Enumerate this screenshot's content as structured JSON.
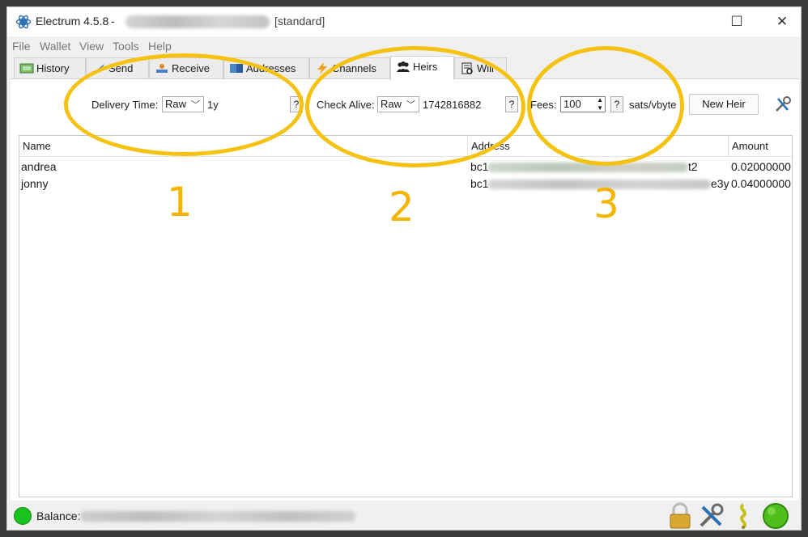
{
  "window": {
    "app_title": "Electrum 4.5.8",
    "separator": "-",
    "wallet_type": "[standard]",
    "maximize_glyph": "☐",
    "close_glyph": "✕"
  },
  "menu": [
    "File",
    "Wallet",
    "View",
    "Tools",
    "Help"
  ],
  "tabs": [
    {
      "label": "History",
      "icon": "history-icon"
    },
    {
      "label": "Send",
      "icon": "send-icon"
    },
    {
      "label": "Receive",
      "icon": "receive-icon"
    },
    {
      "label": "Addresses",
      "icon": "addresses-icon"
    },
    {
      "label": "Channels",
      "icon": "channels-icon"
    },
    {
      "label": "Heirs",
      "icon": "heirs-icon",
      "active": true
    },
    {
      "label": "Will",
      "icon": "will-icon"
    }
  ],
  "toolbar": {
    "delivery_time_label": "Delivery Time:",
    "delivery_time_mode": "Raw",
    "delivery_time_value": "1y",
    "check_alive_label": "Check Alive:",
    "check_alive_mode": "Raw",
    "check_alive_value": "1742816882",
    "fees_label": "Fees:",
    "fees_value": "100",
    "fees_unit": "sats/vbyte",
    "help_glyph": "?",
    "new_heir_label": "New Heir"
  },
  "table": {
    "columns": [
      "Name",
      "Address",
      "Amount"
    ],
    "rows": [
      {
        "name": "andrea",
        "address_prefix": "bc1",
        "address_suffix": "t2",
        "amount": "0.02000000"
      },
      {
        "name": "jonny",
        "address_prefix": "bc1",
        "address_suffix": "e3y",
        "amount": "0.04000000"
      }
    ]
  },
  "status": {
    "balance_label": "Balance:"
  },
  "annotations": [
    "1",
    "2",
    "3"
  ],
  "colors": {
    "annotation": "#f5c211",
    "status_green": "#19c21c"
  }
}
